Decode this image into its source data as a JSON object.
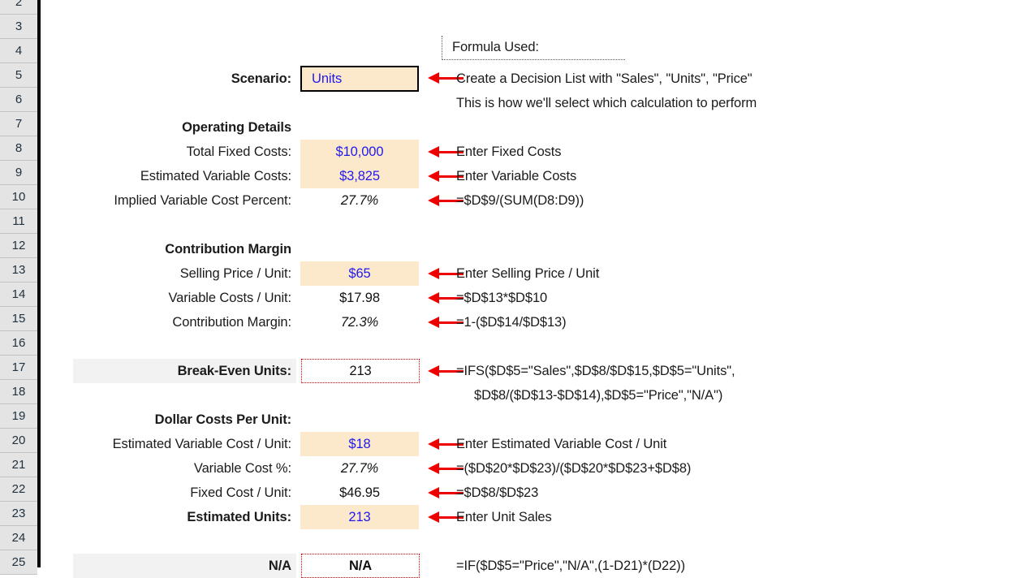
{
  "app": {
    "type": "spreadsheet",
    "colors": {
      "input_fill": "#FCE9CB",
      "input_text": "#2019EF",
      "calc_text": "#111111",
      "header_fill": "#F2F2F2",
      "arrow": "#EF0000",
      "row_header_fill": "#E4E4E4",
      "formula_border": "#E00000"
    }
  },
  "row_headers": [
    "2",
    "3",
    "4",
    "5",
    "6",
    "7",
    "8",
    "9",
    "10",
    "11",
    "12",
    "13",
    "14",
    "15",
    "16",
    "17",
    "18",
    "19",
    "20",
    "21",
    "22",
    "23",
    "24",
    "25"
  ],
  "legend": {
    "formula_used_label": "Formula Used:"
  },
  "rows": {
    "scenario": {
      "label": "Scenario:",
      "value": "Units",
      "note": "Create a Decision List with \"Sales\", \"Units\", \"Price\"",
      "note2": "This is how we'll select which calculation to perform"
    },
    "operating_details": {
      "heading": "Operating Details",
      "items": [
        {
          "label": "Total Fixed Costs:",
          "value": "$10,000",
          "note": "Enter Fixed Costs"
        },
        {
          "label": "Estimated Variable Costs:",
          "value": "$3,825",
          "note": "Enter Variable Costs"
        },
        {
          "label": "Implied Variable Cost Percent:",
          "value": "27.7%",
          "note": "=$D$9/(SUM(D8:D9))"
        }
      ]
    },
    "contribution_margin": {
      "heading": "Contribution Margin",
      "items": [
        {
          "label": "Selling Price / Unit:",
          "value": "$65",
          "note": "Enter Selling Price / Unit"
        },
        {
          "label": "Variable Costs / Unit:",
          "value": "$17.98",
          "note": "=$D$13*$D$10"
        },
        {
          "label": "Contribution Margin:",
          "value": "72.3%",
          "note": "=1-($D$14/$D$13)"
        }
      ]
    },
    "break_even": {
      "label": "Break-Even Units:",
      "value": "213",
      "note_line1": "=IFS($D$5=\"Sales\",$D$8/$D$15,$D$5=\"Units\",",
      "note_line2": "$D$8/($D$13-$D$14),$D$5=\"Price\",\"N/A\")"
    },
    "dollar_costs": {
      "heading": "Dollar Costs Per Unit:",
      "items": [
        {
          "label": "Estimated Variable Cost / Unit:",
          "value": "$18",
          "note": "Enter Estimated Variable Cost / Unit"
        },
        {
          "label": "Variable Cost %:",
          "value": "27.7%",
          "note": "=($D$20*$D$23)/($D$20*$D$23+$D$8)"
        },
        {
          "label": "Fixed Cost / Unit:",
          "value": "$46.95",
          "note": "=$D$8/$D$23"
        },
        {
          "label": "Estimated Units:",
          "value": "213",
          "note": "Enter Unit Sales"
        }
      ]
    },
    "bottom": {
      "label": "N/A",
      "value": "N/A",
      "note": "=IF($D$5=\"Price\",\"N/A\",(1-D21)*(D22))"
    }
  }
}
